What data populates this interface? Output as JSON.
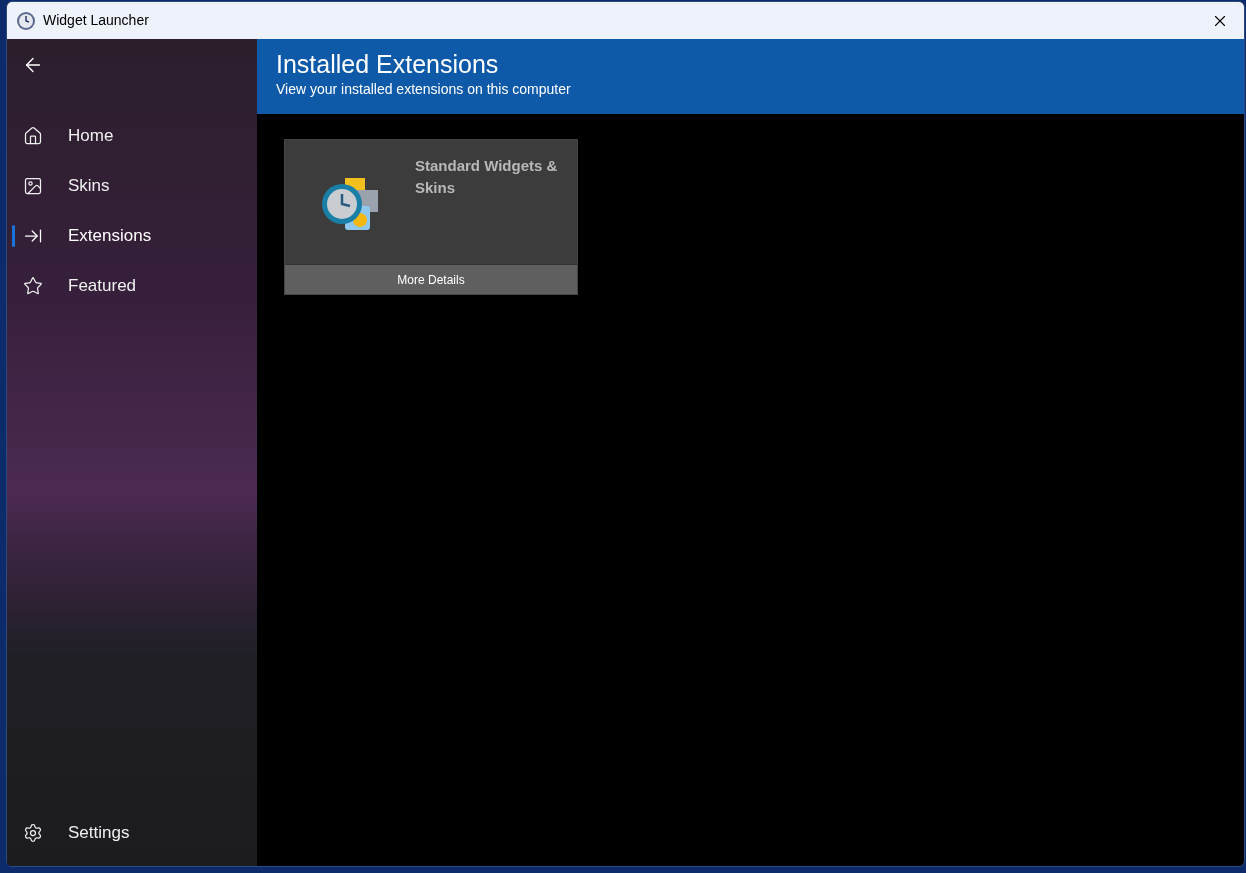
{
  "window": {
    "title": "Widget Launcher"
  },
  "sidebar": {
    "items": [
      {
        "label": "Home",
        "kind": "home",
        "selected": false
      },
      {
        "label": "Skins",
        "kind": "image",
        "selected": false
      },
      {
        "label": "Extensions",
        "kind": "extensions",
        "selected": true
      },
      {
        "label": "Featured",
        "kind": "star",
        "selected": false
      }
    ],
    "footer_item": {
      "label": "Settings",
      "kind": "settings",
      "selected": false
    }
  },
  "header": {
    "title": "Installed Extensions",
    "subtitle": "View your installed extensions on this computer"
  },
  "extensions": [
    {
      "name": "Standard Widgets & Skins",
      "button": "More Details"
    }
  ]
}
